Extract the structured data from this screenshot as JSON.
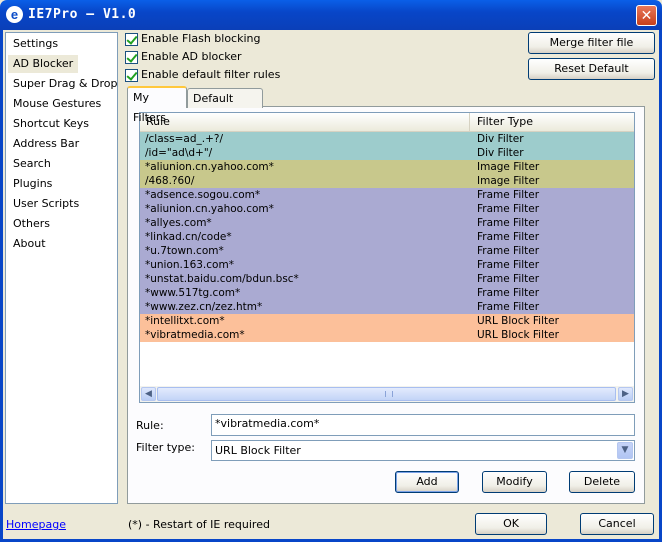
{
  "window": {
    "title": "IE7Pro — V1.0",
    "app_icon_glyph": "e"
  },
  "sidebar": {
    "items": [
      {
        "label": "Settings"
      },
      {
        "label": "AD Blocker"
      },
      {
        "label": "Super Drag & Drop"
      },
      {
        "label": "Mouse Gestures"
      },
      {
        "label": "Shortcut Keys"
      },
      {
        "label": "Address Bar"
      },
      {
        "label": "Search"
      },
      {
        "label": "Plugins"
      },
      {
        "label": "User Scripts"
      },
      {
        "label": "Others"
      },
      {
        "label": "About"
      }
    ],
    "selected": "AD Blocker"
  },
  "options": {
    "flash": {
      "label": "Enable Flash blocking",
      "checked": true
    },
    "ad": {
      "label": "Enable AD blocker",
      "checked": true
    },
    "default_rules": {
      "label": "Enable default filter rules",
      "checked": true
    }
  },
  "buttons": {
    "merge": "Merge filter file",
    "reset": "Reset Default",
    "add": "Add",
    "modify": "Modify",
    "delete": "Delete",
    "ok": "OK",
    "cancel": "Cancel"
  },
  "tabs": {
    "my_filters": "My Filters",
    "default_filters": "Default Filters",
    "active": "My Filters"
  },
  "table": {
    "columns": {
      "rule": "Rule",
      "type": "Filter Type"
    },
    "rows": [
      {
        "rule": "/class=ad_.+?/",
        "type": "Div Filter"
      },
      {
        "rule": "/id=\"ad\\d+\"/",
        "type": "Div Filter"
      },
      {
        "rule": "*aliunion.cn.yahoo.com*",
        "type": "Image Filter"
      },
      {
        "rule": "/468.?60/",
        "type": "Image Filter"
      },
      {
        "rule": "*adsence.sogou.com*",
        "type": "Frame Filter"
      },
      {
        "rule": "*aliunion.cn.yahoo.com*",
        "type": "Frame Filter"
      },
      {
        "rule": "*allyes.com*",
        "type": "Frame Filter"
      },
      {
        "rule": "*linkad.cn/code*",
        "type": "Frame Filter"
      },
      {
        "rule": "*u.7town.com*",
        "type": "Frame Filter"
      },
      {
        "rule": "*union.163.com*",
        "type": "Frame Filter"
      },
      {
        "rule": "*unstat.baidu.com/bdun.bsc*",
        "type": "Frame Filter"
      },
      {
        "rule": "*www.517tg.com*",
        "type": "Frame Filter"
      },
      {
        "rule": "*www.zez.cn/zez.htm*",
        "type": "Frame Filter"
      },
      {
        "rule": "*intellitxt.com*",
        "type": "URL Block Filter"
      },
      {
        "rule": "*vibratmedia.com*",
        "type": "URL Block Filter"
      }
    ],
    "type_colors": {
      "Div Filter": "#9dcccc",
      "Image Filter": "#c8c88c",
      "Frame Filter": "#aaaad2",
      "URL Block Filter": "#fcc09a"
    }
  },
  "form": {
    "rule_label": "Rule:",
    "rule_value": "*vibratmedia.com*",
    "type_label": "Filter type:",
    "type_value": "URL Block Filter"
  },
  "footer": {
    "homepage": "Homepage",
    "note": "(*) - Restart of IE required"
  }
}
